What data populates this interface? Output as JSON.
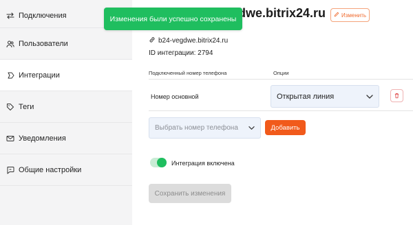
{
  "sidebar": {
    "items": [
      {
        "label": "Подключения",
        "icon": "connections-icon",
        "active": false
      },
      {
        "label": "Пользователи",
        "icon": "users-icon",
        "active": false
      },
      {
        "label": "Интеграции",
        "icon": "integrations-icon",
        "active": true
      },
      {
        "label": "Теги",
        "icon": "tag-icon",
        "active": false
      },
      {
        "label": "Уведомления",
        "icon": "mail-icon",
        "active": false
      },
      {
        "label": "Общие настройки",
        "icon": "chat-settings-icon",
        "active": false
      }
    ]
  },
  "toast": {
    "message": "Изменения были успешно сохранены",
    "color": "#1fbe5f"
  },
  "header": {
    "title": "dwe.bitrix24.ru",
    "edit_label": "Изменить"
  },
  "integration": {
    "link": "b24-vegdwe.bitrix24.ru",
    "id_text": "ID интеграции: 2794"
  },
  "table": {
    "col_phone": "Подключенный номер телефона",
    "col_options": "Опции",
    "rows": [
      {
        "phone": "Номер основной",
        "option": "Открытая линия"
      }
    ]
  },
  "add_phone": {
    "placeholder": "Выбрать номер телефона",
    "add_label": "Добавить"
  },
  "toggle": {
    "label": "Интеграция включена",
    "on": true
  },
  "save_label": "Сохранить изменения",
  "colors": {
    "accent": "#f15a1b",
    "success": "#1fbe5f",
    "sidebar_bg": "#f4f4f5"
  }
}
